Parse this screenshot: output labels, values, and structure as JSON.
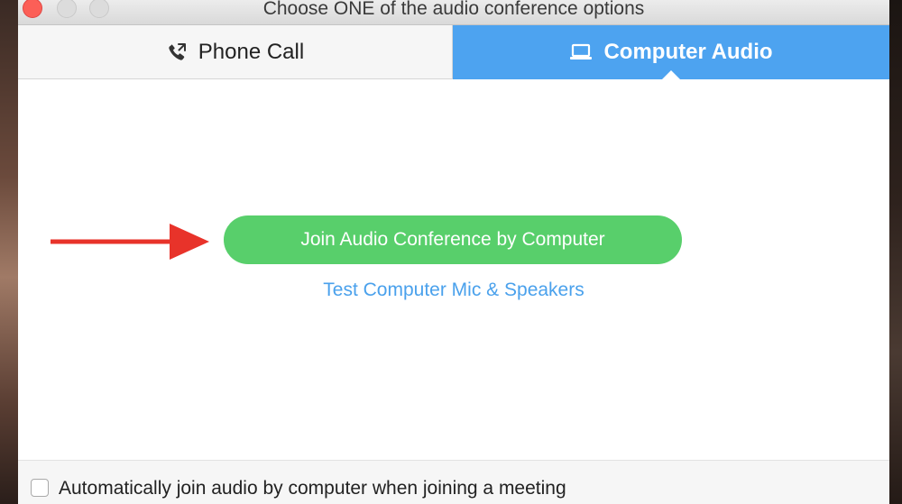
{
  "window": {
    "title": "Choose ONE of the audio conference options"
  },
  "tabs": [
    {
      "label": "Phone Call",
      "icon": "phone-icon",
      "selected": false
    },
    {
      "label": "Computer Audio",
      "icon": "laptop-icon",
      "selected": true
    }
  ],
  "main": {
    "join_button_label": "Join Audio Conference by Computer",
    "test_link_label": "Test Computer Mic & Speakers"
  },
  "footer": {
    "auto_join_label": "Automatically join audio by computer when joining a meeting",
    "auto_join_checked": false
  },
  "colors": {
    "tab_active": "#4da3f0",
    "join_button": "#58cf6b",
    "link": "#4aa1ec",
    "arrow": "#e8332a"
  }
}
